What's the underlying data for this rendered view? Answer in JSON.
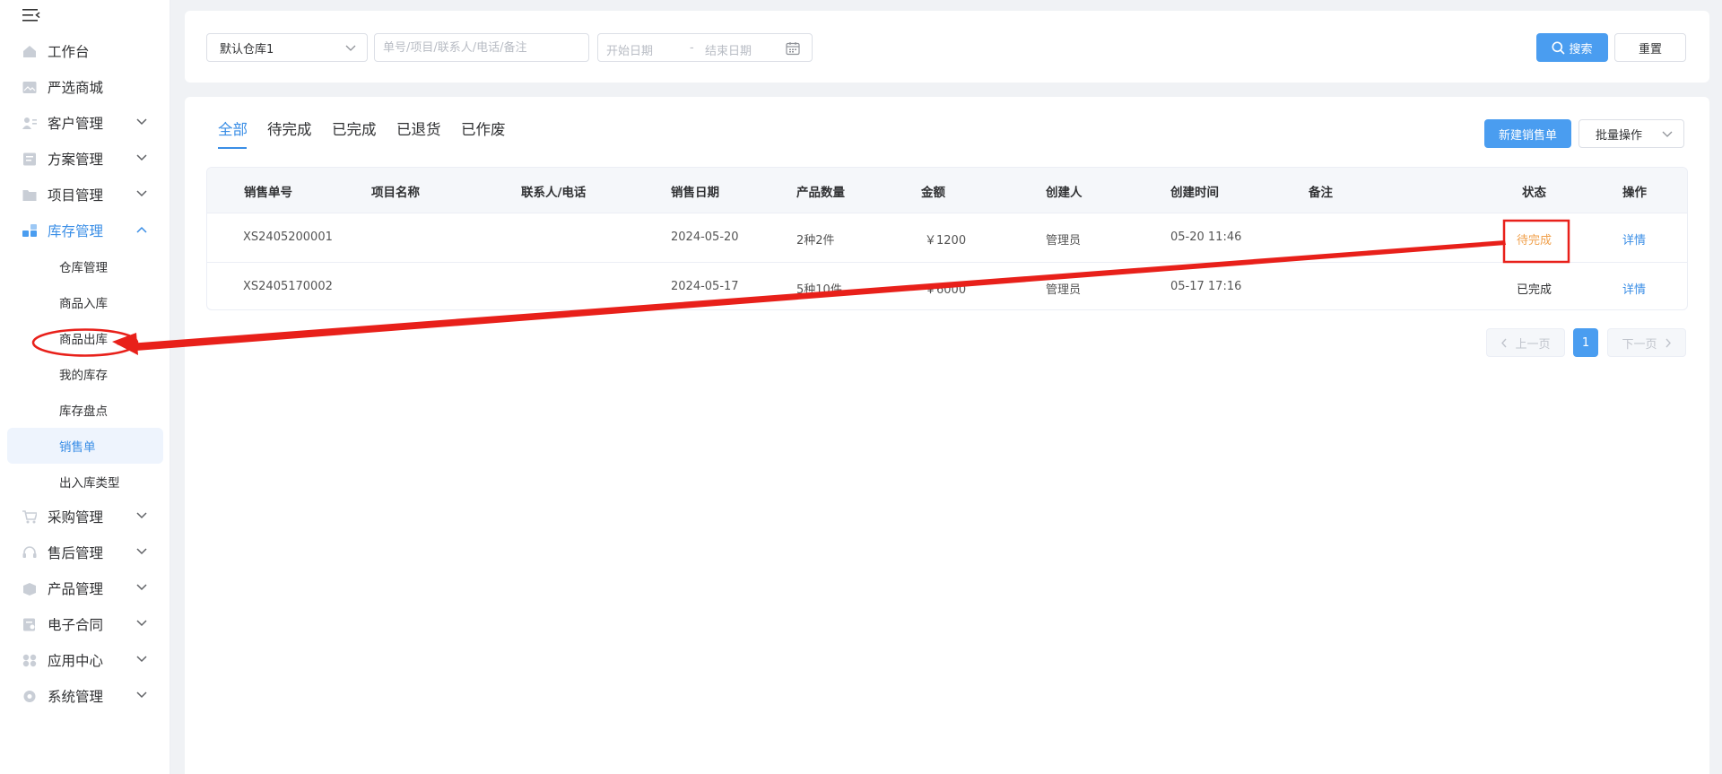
{
  "sidebar": {
    "items": [
      {
        "label": "工作台"
      },
      {
        "label": "严选商城"
      },
      {
        "label": "客户管理"
      },
      {
        "label": "方案管理"
      },
      {
        "label": "项目管理"
      },
      {
        "label": "库存管理"
      },
      {
        "label": "采购管理"
      },
      {
        "label": "售后管理"
      },
      {
        "label": "产品管理"
      },
      {
        "label": "电子合同"
      },
      {
        "label": "应用中心"
      },
      {
        "label": "系统管理"
      }
    ],
    "sub_items": [
      {
        "label": "仓库管理"
      },
      {
        "label": "商品入库"
      },
      {
        "label": "商品出库"
      },
      {
        "label": "我的库存"
      },
      {
        "label": "库存盘点"
      },
      {
        "label": "销售单"
      },
      {
        "label": "出入库类型"
      }
    ]
  },
  "filter": {
    "warehouse": "默认仓库1",
    "search_placeholder": "单号/项目/联系人/电话/备注",
    "start_date_placeholder": "开始日期",
    "date_separator": "-",
    "end_date_placeholder": "结束日期",
    "search_label": "搜索",
    "reset_label": "重置"
  },
  "tabs": [
    {
      "label": "全部"
    },
    {
      "label": "待完成"
    },
    {
      "label": "已完成"
    },
    {
      "label": "已退货"
    },
    {
      "label": "已作废"
    }
  ],
  "actions": {
    "new_label": "新建销售单",
    "batch_label": "批量操作"
  },
  "table": {
    "headers": [
      "销售单号",
      "项目名称",
      "联系人/电话",
      "销售日期",
      "产品数量",
      "金额",
      "创建人",
      "创建时间",
      "备注",
      "状态",
      "操作"
    ],
    "rows": [
      {
        "order_no": "XS2405200001",
        "project": "",
        "contact": "",
        "date": "2024-05-20",
        "qty": "2种2件",
        "amount": "￥1200",
        "creator": "管理员",
        "created": "05-20 11:46",
        "remark": "",
        "status": "待完成",
        "action": "详情"
      },
      {
        "order_no": "XS2405170002",
        "project": "",
        "contact": "",
        "date": "2024-05-17",
        "qty": "5种10件",
        "amount": "￥6000",
        "creator": "管理员",
        "created": "05-17 17:16",
        "remark": "",
        "status": "已完成",
        "action": "详情"
      }
    ]
  },
  "pagination": {
    "prev_label": "上一页",
    "current": "1",
    "next_label": "下一页"
  },
  "colors": {
    "primary": "#4a9df0",
    "active_text": "#3a8ee6",
    "pending": "#f0a04b",
    "annotation": "#e8201a"
  }
}
